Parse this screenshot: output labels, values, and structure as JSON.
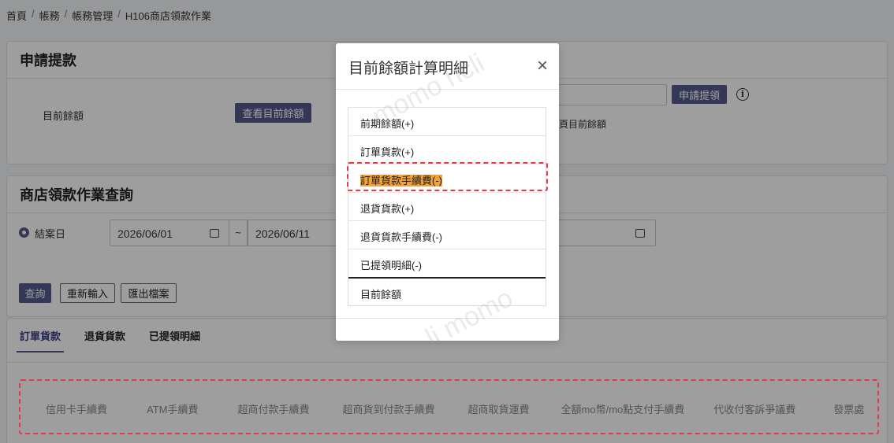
{
  "breadcrumb": [
    "首頁",
    "帳務",
    "帳務管理",
    "H106商店領款作業"
  ],
  "apply": {
    "title": "申請提款",
    "balance_label": "目前餘額",
    "view_balance_btn": "查看目前餘額",
    "apply_btn": "申請提領",
    "info_icon": "info-icon",
    "hint": "頁目前餘額"
  },
  "query": {
    "title": "商店領款作業查詢",
    "radio_label": "結案日",
    "date_from": "2026/06/01",
    "tilde": "~",
    "date_to": "2026/06/11",
    "buttons": {
      "search": "查詢",
      "reset": "重新輸入",
      "export": "匯出檔案"
    }
  },
  "tabs": [
    "訂單貨款",
    "退貨貨款",
    "已提領明細"
  ],
  "columns": [
    "信用卡手續費",
    "ATM手續費",
    "超商付款手續費",
    "超商貨到付款手續費",
    "超商取貨運費",
    "全額mo幣/mo點支付手續費",
    "代收付客訴爭議費",
    "發票處"
  ],
  "modal": {
    "title": "目前餘額計算明細",
    "close": "×",
    "items": [
      "前期餘額(+)",
      "訂單貨款(+)",
      "訂單貨款手續費(-)",
      "退貨貨款(+)",
      "退貨貨款手續費(-)",
      "已提領明細(-)"
    ],
    "total": "目前餘額"
  },
  "colors": {
    "accent": "#565a8d",
    "highlight": "#f0a139",
    "annotation": "#e23a4a"
  }
}
